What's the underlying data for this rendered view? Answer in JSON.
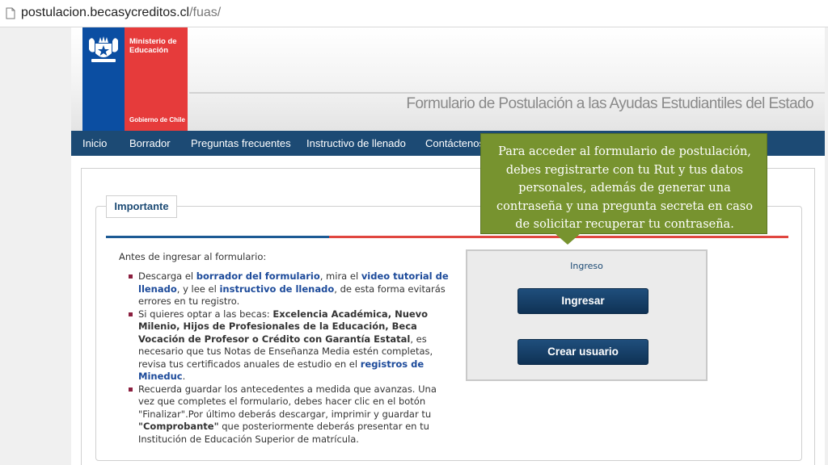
{
  "browser": {
    "url_host": "postulacion.becasycreditos.cl",
    "url_path": "/fuas/"
  },
  "header": {
    "logo": {
      "ministry_line1": "Ministerio de",
      "ministry_line2": "Educación",
      "government": "Gobierno de Chile",
      "colors": {
        "blue": "#0b4ea2",
        "red": "#e63b3b"
      }
    },
    "title": "Formulario de Postulación a las Ayudas Estudiantiles del Estado"
  },
  "nav": {
    "items": [
      {
        "label": "Inicio"
      },
      {
        "label": "Borrador"
      },
      {
        "label": "Preguntas frecuentes"
      },
      {
        "label": "Instructivo de llenado"
      },
      {
        "label": "Contáctenos"
      }
    ]
  },
  "important": {
    "tab_label": "Importante",
    "intro": "Antes de ingresar al formulario:",
    "bullet1": {
      "t1": "Descarga el ",
      "link1": "borrador del formulario",
      "t2": ", mira el ",
      "link2": "video tutorial de llenado",
      "t3": ", y lee el ",
      "link3": "instructivo de llenado",
      "t4": ", de esta forma evitarás errores en tu registro."
    },
    "bullet2": {
      "t1": "Si quieres optar a las becas: ",
      "bold1": "Excelencia Académica, Nuevo Milenio, Hijos de Profesionales de la Educación, Beca Vocación de Profesor o Crédito con Garantía Estatal",
      "t2": ", es necesario que tus Notas de Enseñanza Media estén completas, revisa tus certificados anuales de estudio en el ",
      "link1": "registros de Mineduc",
      "t3": "."
    },
    "bullet3": {
      "t1": "Recuerda guardar los antecedentes a medida que avanzas. Una vez que completes el formulario, debes hacer clic en el botón \"Finalizar\".Por último deberás descargar, imprimir y guardar tu ",
      "bold1": "\"Comprobante\"",
      "t2": " que posteriormente deberás presentar en tu Institución de Educación Superior de matrícula."
    }
  },
  "login": {
    "title": "Ingreso",
    "login_button": "Ingresar",
    "create_user_button": "Crear usuario"
  },
  "callout": {
    "text": "Para acceder al formulario de postulación, debes registrarte con tu Rut y tus datos personales, además de generar una contraseña y una pregunta secreta en caso de solicitar recuperar tu contraseña.",
    "color": "#77932f"
  },
  "colors": {
    "nav_bg": "#1c4a74",
    "divider_blue": "#1c5a94",
    "divider_red": "#e0463f",
    "link": "#1c4a9a",
    "bullet": "#8b1f3f"
  }
}
